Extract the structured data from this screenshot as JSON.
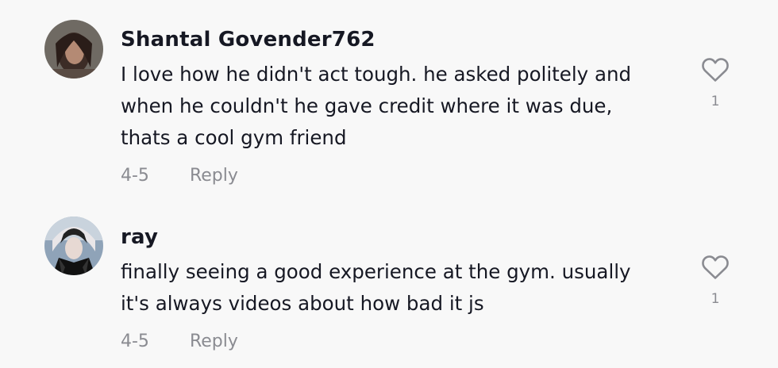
{
  "comments": [
    {
      "username": "Shantal Govender762",
      "text_lines": [
        "I love how he didn't act tough. he asked politely and",
        "when he couldn't he gave credit where it was due,",
        "thats a cool gym friend"
      ],
      "date": "4-5",
      "reply_label": "Reply",
      "like_count": "1",
      "avatar_icon": "user-avatar-photo",
      "like_icon": "heart-outline-icon"
    },
    {
      "username": "ray",
      "text_lines": [
        "finally seeing a good experience at the gym. usually",
        "it's always videos about how bad it js"
      ],
      "date": "4-5",
      "reply_label": "Reply",
      "like_count": "1",
      "avatar_icon": "user-avatar-photo",
      "like_icon": "heart-outline-icon"
    }
  ],
  "colors": {
    "background": "#f8f8f8",
    "text_primary": "#161823",
    "text_secondary": "#8a8b91"
  }
}
